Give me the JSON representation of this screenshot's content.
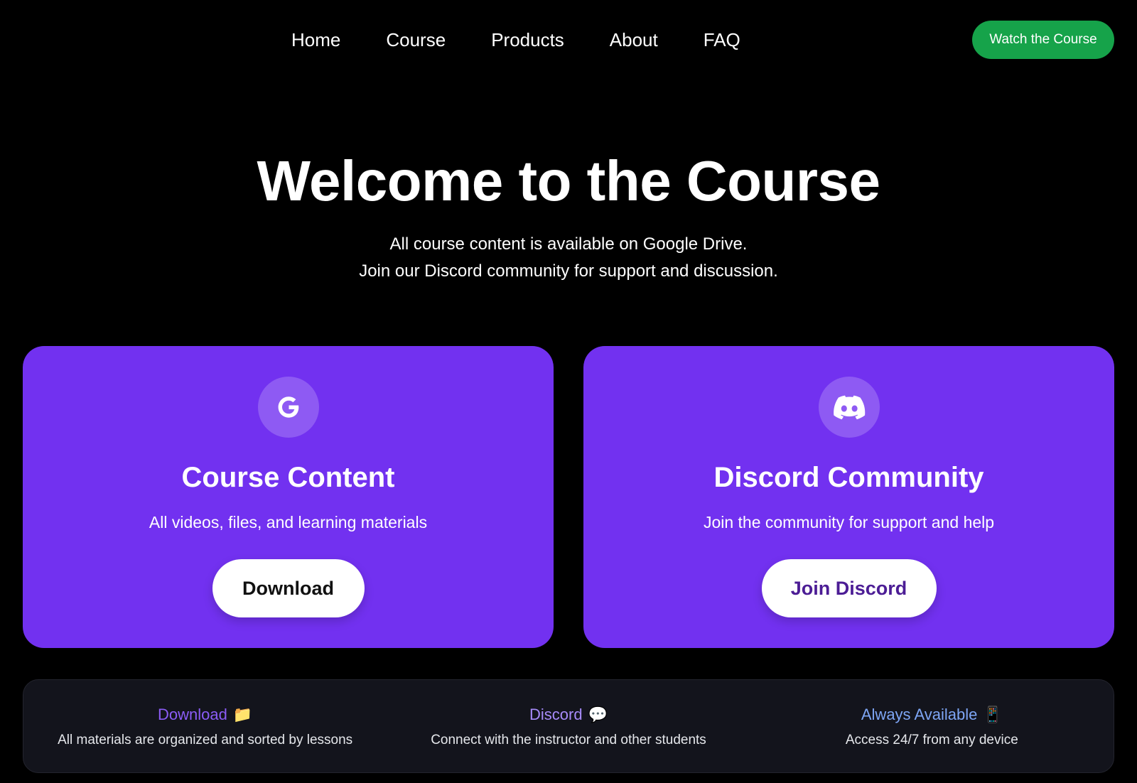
{
  "nav": {
    "links": [
      "Home",
      "Course",
      "Products",
      "About",
      "FAQ"
    ],
    "cta_label": "Watch the Course"
  },
  "hero": {
    "title": "Welcome to the Course",
    "subtitle_line1": "All course content is available on Google Drive.",
    "subtitle_line2": "Join our Discord community for support and discussion."
  },
  "cards": [
    {
      "icon": "google-icon",
      "title": "Course Content",
      "description": "All videos, files, and learning materials",
      "button_label": "Download"
    },
    {
      "icon": "discord-icon",
      "title": "Discord Community",
      "description": "Join the community for support and help",
      "button_label": "Join Discord"
    }
  ],
  "features": [
    {
      "title": "Download",
      "icon": "folder-icon",
      "glyph": "📁",
      "description": "All materials are organized and sorted by lessons",
      "color": "#8b5cf6"
    },
    {
      "title": "Discord",
      "icon": "speech-bubble-icon",
      "glyph": "💬",
      "description": "Connect with the instructor and other students",
      "color": "#a78bfa"
    },
    {
      "title": "Always Available",
      "icon": "mobile-phone-icon",
      "glyph": "📱",
      "description": "Access 24/7 from any device",
      "color": "#7ea6f5"
    }
  ],
  "colors": {
    "background": "#000000",
    "card": "#7231f0",
    "cta": "#16a34a",
    "features_bar": "#13141c"
  }
}
